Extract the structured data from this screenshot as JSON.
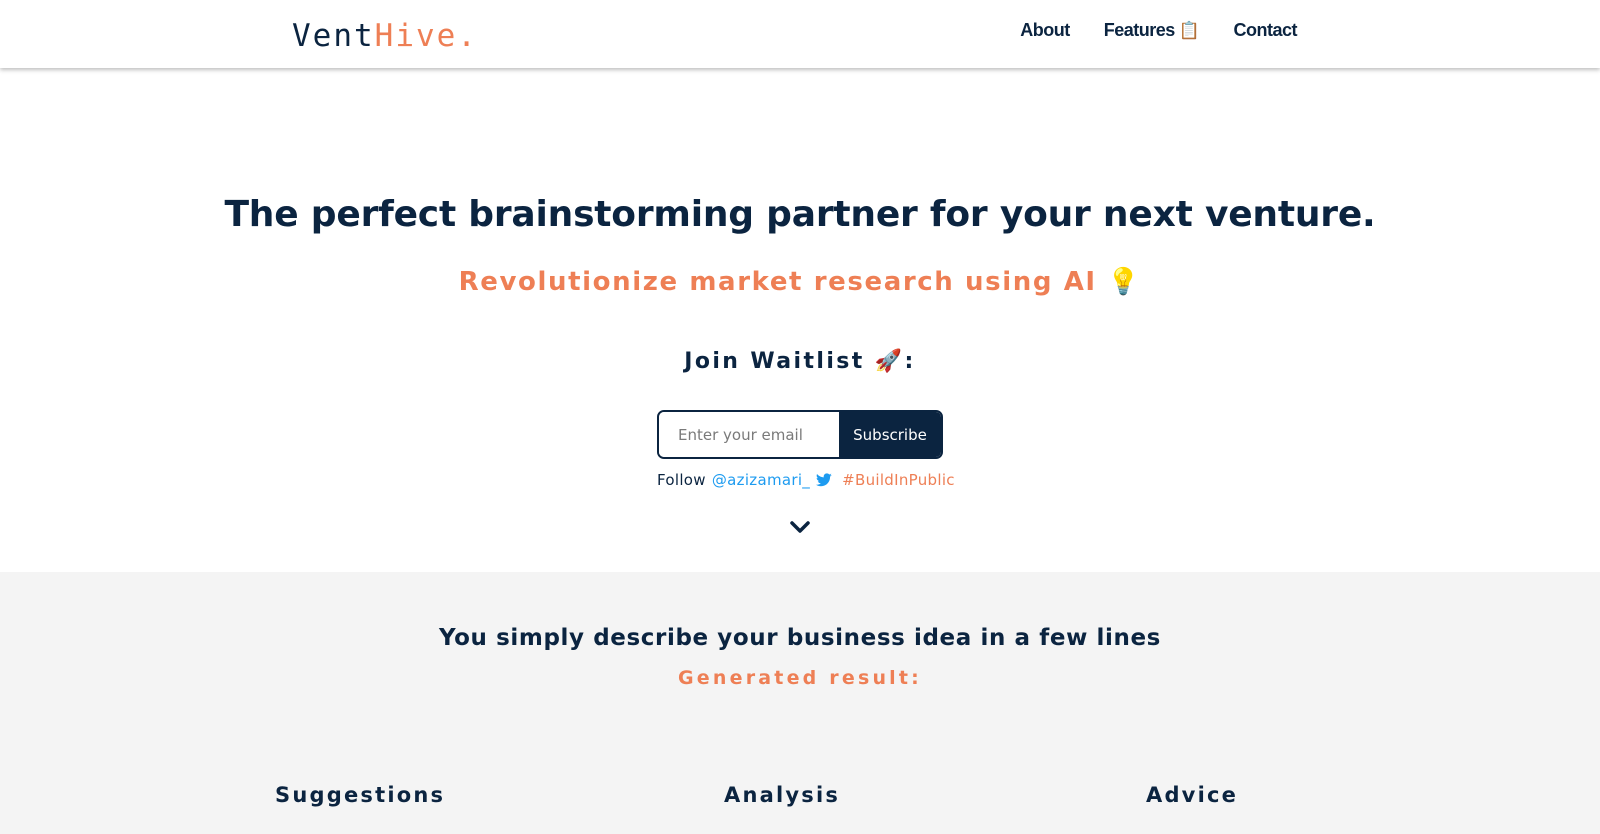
{
  "navbar": {
    "logo_main": "Vent",
    "logo_accent": "Hive.",
    "links": [
      {
        "label": "About"
      },
      {
        "label": "Features",
        "emoji": "📋"
      },
      {
        "label": "Contact"
      }
    ]
  },
  "hero": {
    "headline": "The perfect brainstorming partner for your next venture.",
    "subheadline": "Revolutionize market research using AI 💡",
    "waitlist_label": "Join Waitlist 🚀:",
    "email_placeholder": "Enter your email",
    "subscribe_label": "Subscribe",
    "follow_text": "Follow",
    "twitter_handle": "@azizamari_",
    "hashtag": "#BuildInPublic"
  },
  "features": {
    "title": "You simply describe your business idea in a few lines",
    "subtitle": "Generated result:",
    "columns": [
      "Suggestions",
      "Analysis",
      "Advice"
    ]
  },
  "colors": {
    "navy": "#0b2440",
    "accent_orange": "#ee7f55",
    "twitter_blue": "#1d9bf0",
    "section_bg": "#f4f4f4"
  },
  "icons": {
    "twitter": "twitter-bird-icon",
    "scroll": "chevron-down-icon"
  }
}
